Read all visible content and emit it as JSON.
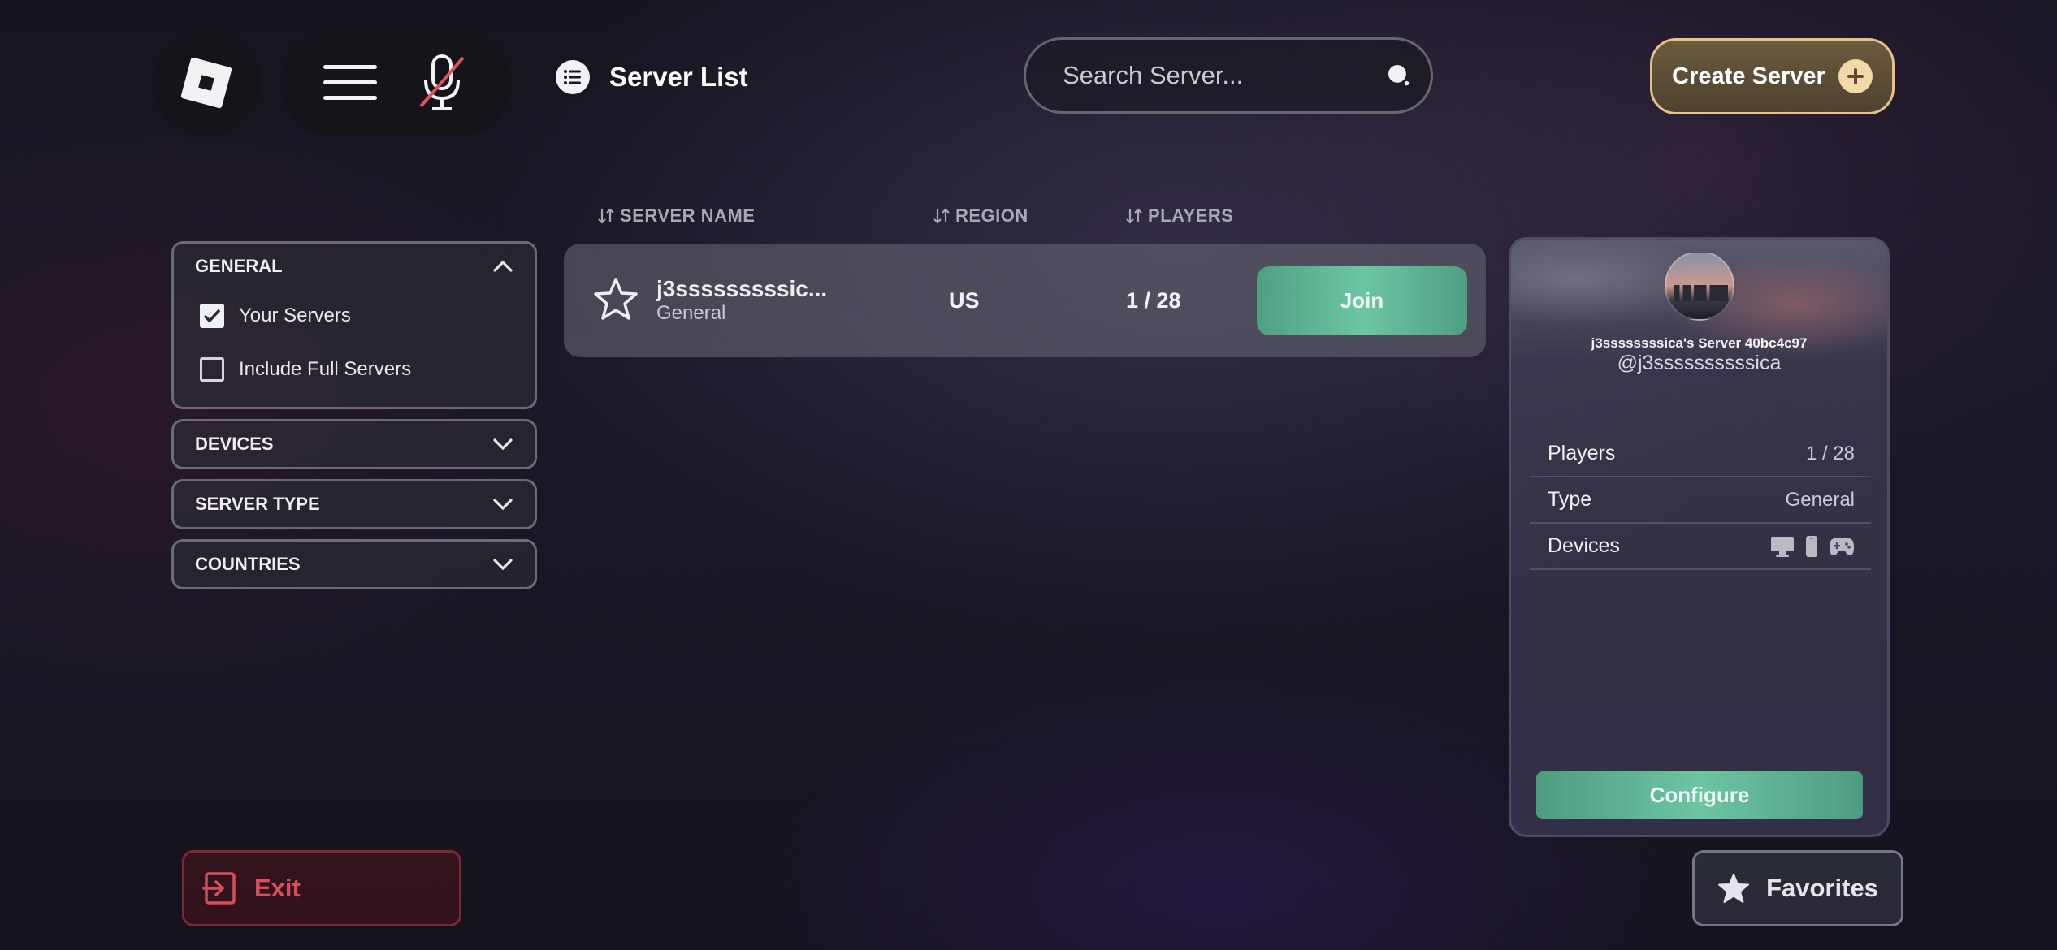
{
  "header": {
    "title": "Server List",
    "search_placeholder": "Search Server...",
    "create_label": "Create Server"
  },
  "columns": {
    "server_name": "SERVER NAME",
    "region": "REGION",
    "players": "PLAYERS"
  },
  "filters": {
    "general": {
      "title": "GENERAL",
      "expanded": true,
      "options": [
        {
          "label": "Your Servers",
          "checked": true
        },
        {
          "label": "Include Full Servers",
          "checked": false
        }
      ]
    },
    "devices": {
      "title": "DEVICES",
      "expanded": false
    },
    "server_type": {
      "title": "SERVER TYPE",
      "expanded": false
    },
    "countries": {
      "title": "COUNTRIES",
      "expanded": false
    }
  },
  "servers": [
    {
      "name": "j3sssssssssic...",
      "type": "General",
      "region": "US",
      "players": "1 / 28",
      "join_label": "Join"
    }
  ],
  "detail": {
    "server_name": "j3ssssssssica's Server 40bc4c97",
    "handle": "@j3ssssssssssica",
    "rows": [
      {
        "key": "Players",
        "value": "1 / 28"
      },
      {
        "key": "Type",
        "value": "General"
      },
      {
        "key": "Devices",
        "icons": [
          "desktop-icon",
          "phone-icon",
          "gamepad-icon"
        ]
      }
    ],
    "configure_label": "Configure"
  },
  "footer": {
    "exit_label": "Exit",
    "favorites_label": "Favorites"
  },
  "colors": {
    "accent_green": "#6cc6a3",
    "create_gold": "#e4c28a",
    "exit_red": "#d4515c",
    "mic_muted_red": "#e0525c"
  }
}
